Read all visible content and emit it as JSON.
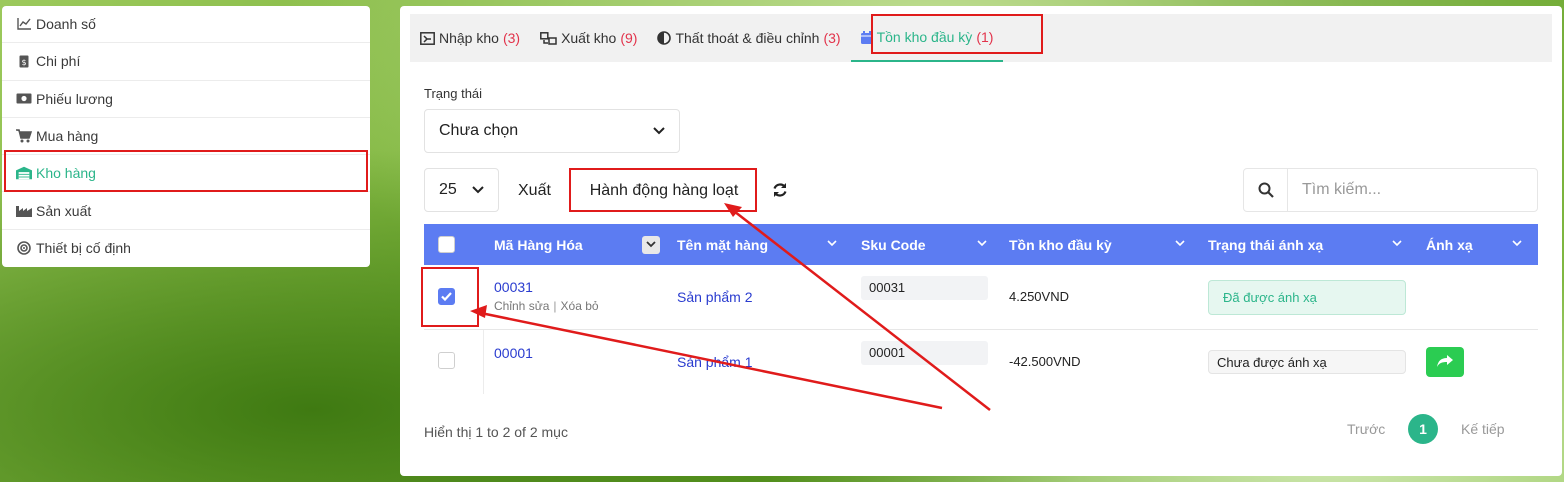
{
  "sidebar": {
    "items": [
      {
        "label": "Doanh số",
        "icon": "chart-line-icon"
      },
      {
        "label": "Chi phí",
        "icon": "invoice-icon"
      },
      {
        "label": "Phiếu lương",
        "icon": "money-icon"
      },
      {
        "label": "Mua hàng",
        "icon": "cart-icon"
      },
      {
        "label": "Kho hàng",
        "icon": "warehouse-icon"
      },
      {
        "label": "Sản xuất",
        "icon": "factory-icon"
      },
      {
        "label": "Thiết bị cố định",
        "icon": "target-icon"
      }
    ],
    "active_index": 4
  },
  "tabs": [
    {
      "label": "Nhập kho",
      "count": "(3)",
      "icon": "import-icon"
    },
    {
      "label": "Xuất kho",
      "count": "(9)",
      "icon": "export-icon"
    },
    {
      "label": "Thất thoát & điều chỉnh",
      "count": "(3)",
      "icon": "half-circle-icon"
    },
    {
      "label": "Tồn kho đầu kỳ",
      "count": "(1)",
      "icon": "calendar-icon"
    }
  ],
  "filters": {
    "status_label": "Trạng thái",
    "status_value": "Chưa chọn"
  },
  "toolbar": {
    "page_size": "25",
    "export_label": "Xuất",
    "bulk_label": "Hành động hàng loạt",
    "search_placeholder": "Tìm kiếm..."
  },
  "table": {
    "columns": [
      "Mã Hàng Hóa",
      "Tên mặt hàng",
      "Sku Code",
      "Tồn kho đầu kỳ",
      "Trạng thái ánh xạ",
      "Ánh xạ"
    ],
    "rows": [
      {
        "code": "00031",
        "edit": "Chỉnh sửa",
        "delete": "Xóa bỏ",
        "name": "Sản phẩm 2",
        "sku": "00031",
        "stock": "4.250VND",
        "status": "Đã được ánh xạ",
        "checked": true
      },
      {
        "code": "00001",
        "name": "Sản phẩm 1",
        "sku": "00001",
        "stock": "-42.500VND",
        "status": "Chưa được ánh xạ",
        "checked": false
      }
    ]
  },
  "footer": {
    "info": "Hiển thị 1 to 2 of 2 mục",
    "prev": "Trước",
    "current_page": "1",
    "next": "Kế tiếp"
  },
  "colors": {
    "accent": "#2bb58a",
    "header": "#5c7cf2",
    "count": "#e2334b",
    "highlight": "#e01b1b"
  }
}
